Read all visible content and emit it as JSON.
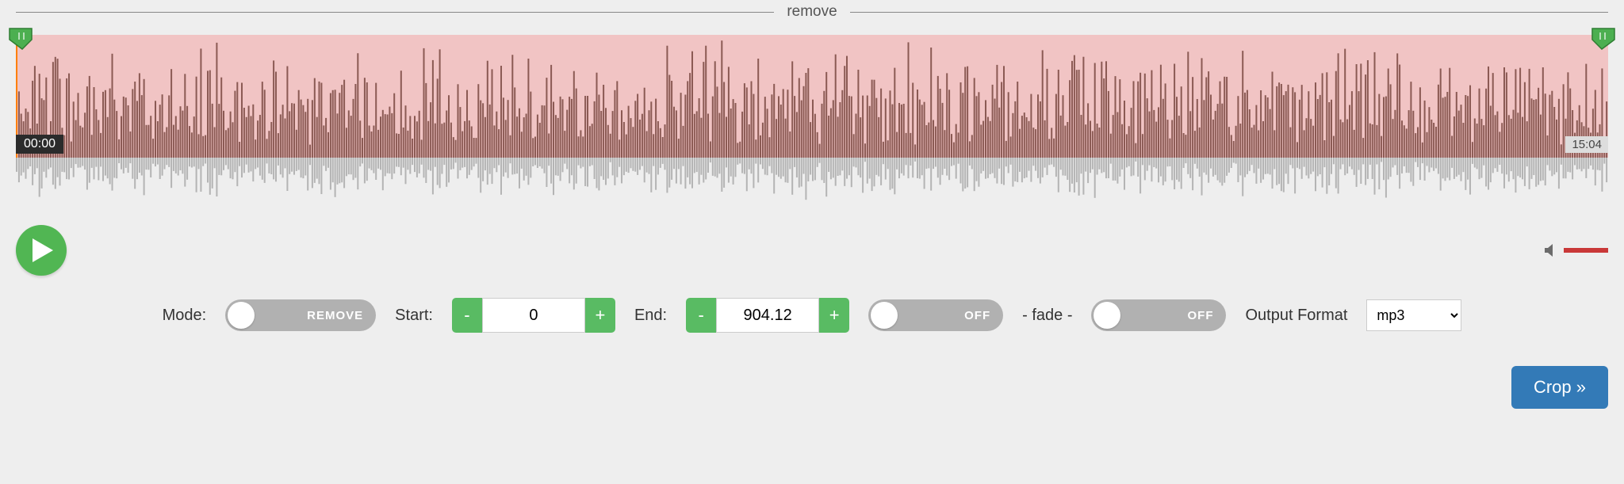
{
  "divider_label": "remove",
  "waveform": {
    "start_time_label": "00:00",
    "end_time_label": "15:04"
  },
  "controls": {
    "mode_label": "Mode:",
    "mode_toggle": "REMOVE",
    "start_label": "Start:",
    "start_value": "0",
    "end_label": "End:",
    "end_value": "904.12",
    "minus": "-",
    "plus": "+",
    "fade_in_toggle": "OFF",
    "fade_sep": "- fade -",
    "fade_out_toggle": "OFF",
    "output_label": "Output Format",
    "output_value": "mp3"
  },
  "crop_label": "Crop »"
}
